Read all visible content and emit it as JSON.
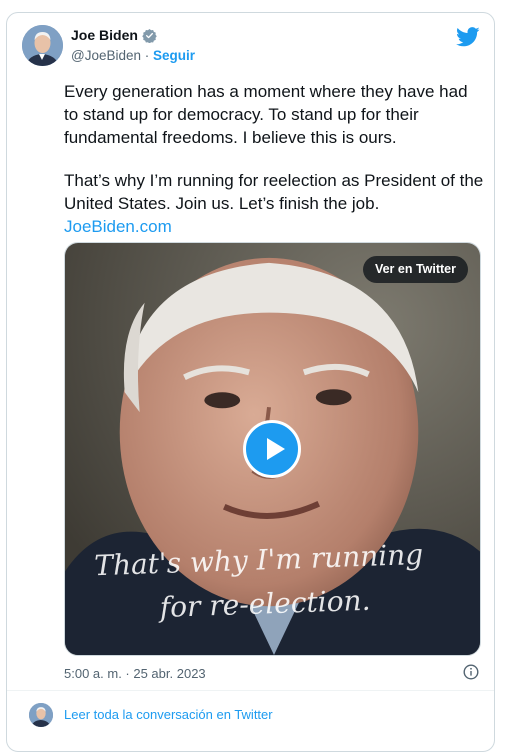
{
  "tweet": {
    "author_name": "Joe Biden",
    "handle": "@JoeBiden",
    "separator": "·",
    "follow_label": "Seguir",
    "paragraph1": "Every generation has a moment where they have had to stand up for democracy. To stand up for their fundamental freedoms. I believe this is ours.",
    "paragraph2": "That’s why I’m running for reelection as President of the United States. Join us. Let’s finish the job.",
    "link_text": "JoeBiden.com",
    "timestamp": "5:00 a. m. · 25 abr. 2023"
  },
  "media": {
    "view_label": "Ver en Twitter",
    "caption_line1": "That's why I'm running",
    "caption_line2": "for re-election."
  },
  "footer": {
    "conversation_label": "Leer toda la conversación en Twitter"
  },
  "colors": {
    "accent": "#1d9bf0",
    "secondary_text": "#536471",
    "border": "#cfd9de"
  },
  "icons": [
    "verified-badge-icon",
    "twitter-bird-icon",
    "play-icon",
    "info-icon"
  ]
}
